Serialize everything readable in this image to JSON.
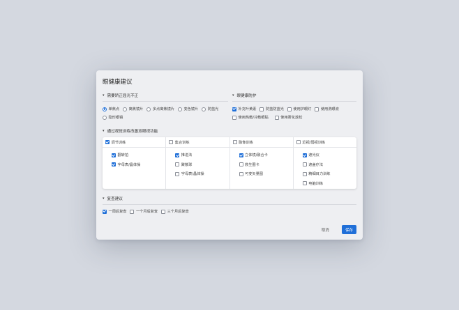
{
  "dialog": {
    "title": "眼健康建议",
    "cancel_label": "取消",
    "save_label": "保存"
  },
  "accent_color": "#1f6fd8",
  "sections": {
    "correction": {
      "title": "需要矫正屈光不正",
      "options": [
        {
          "label": "单焦点",
          "selected": true
        },
        {
          "label": "离焦镜片",
          "selected": false
        },
        {
          "label": "多点离焦镜片",
          "selected": false
        },
        {
          "label": "变色镜片",
          "selected": false
        },
        {
          "label": "防蓝光",
          "selected": false
        },
        {
          "label": "隐形眼镜",
          "selected": false
        }
      ]
    },
    "protection": {
      "title": "眼健康防护",
      "options": [
        {
          "label": "补充叶黄素",
          "checked": true
        },
        {
          "label": "防蓝防蓝光",
          "checked": false
        },
        {
          "label": "使用护眼灯",
          "checked": false
        },
        {
          "label": "使用洗眼液",
          "checked": false
        },
        {
          "label": "使用热敷/冷敷眼贴",
          "checked": false
        },
        {
          "label": "使用雾化放松",
          "checked": false
        }
      ]
    },
    "training": {
      "title": "通过视觉训练改善双眼视功能",
      "columns": [
        {
          "label": "调节训练",
          "checked": true,
          "items": [
            {
              "label": "翻转拍",
              "checked": true
            },
            {
              "label": "字母表/晶体操",
              "checked": true
            }
          ]
        },
        {
          "label": "集合训练",
          "checked": false,
          "items": [
            {
              "label": "推进法",
              "checked": true
            },
            {
              "label": "聚散球",
              "checked": false
            },
            {
              "label": "字母表/晶体操",
              "checked": false
            }
          ]
        },
        {
          "label": "融像训练",
          "checked": false,
          "items": [
            {
              "label": "立体镜/融合卡",
              "checked": true
            },
            {
              "label": "救生圈卡",
              "checked": false
            },
            {
              "label": "可变矢量图",
              "checked": false
            }
          ]
        },
        {
          "label": "近视/弱视训练",
          "checked": false,
          "items": [
            {
              "label": "遮光仪",
              "checked": true
            },
            {
              "label": "遮盖疗法",
              "checked": false
            },
            {
              "label": "精细目力训练",
              "checked": false
            },
            {
              "label": "电脑训练",
              "checked": false
            }
          ]
        }
      ]
    },
    "review": {
      "title": "复查建议",
      "options": [
        {
          "label": "一周后复查",
          "checked": true
        },
        {
          "label": "一个月后复查",
          "checked": false
        },
        {
          "label": "三个月后复查",
          "checked": false
        }
      ]
    }
  },
  "icons": {
    "caret": "caret-down-icon"
  }
}
